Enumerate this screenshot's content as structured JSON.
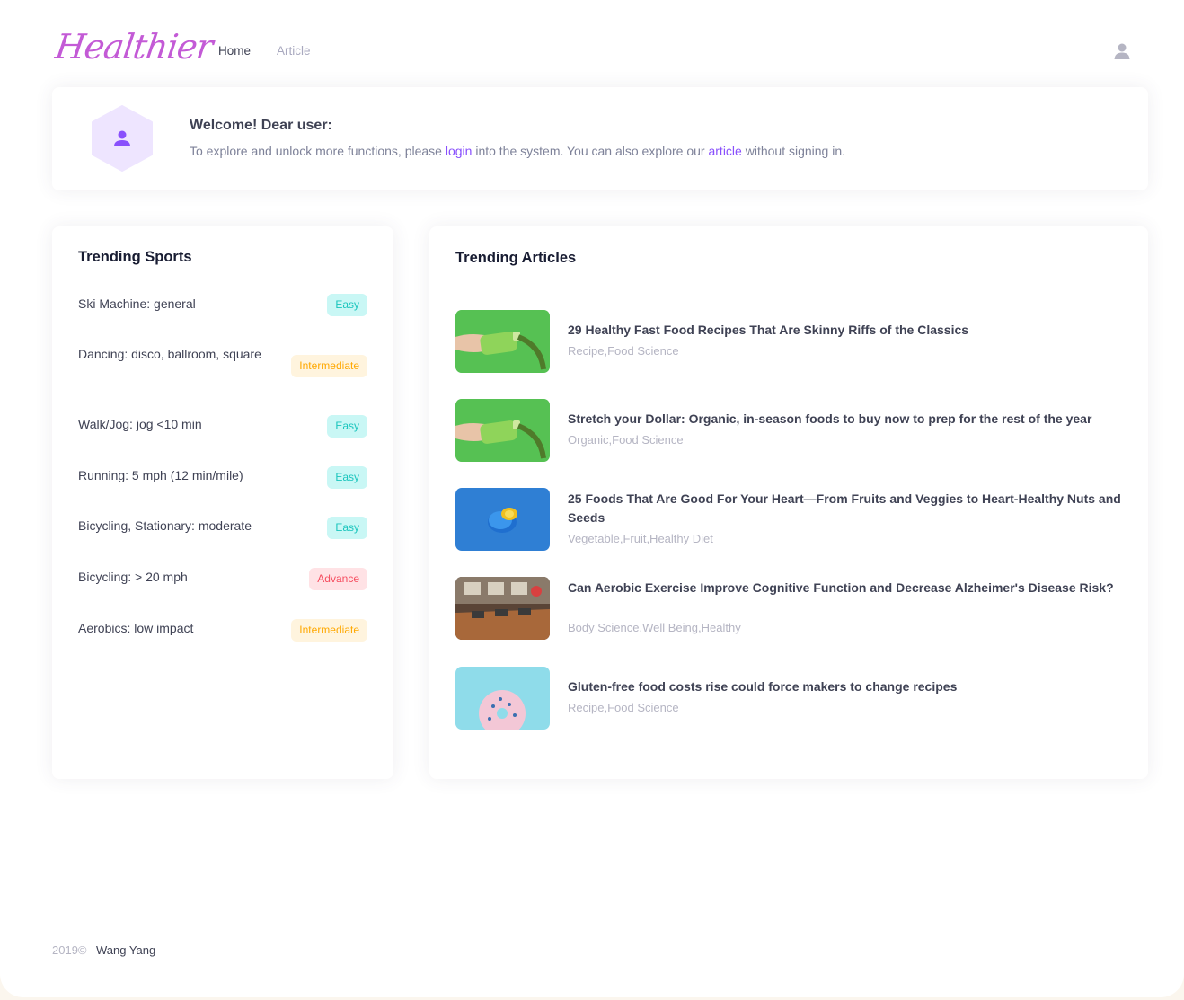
{
  "header": {
    "logo": "Healthier",
    "nav": [
      {
        "label": "Home"
      },
      {
        "label": "Article"
      }
    ],
    "user_icon": "user-icon"
  },
  "welcome": {
    "title": "Welcome! Dear user:",
    "text_before": "To explore and unlock more functions, please ",
    "login_link": "login",
    "text_middle": " into the system. You can also explore our ",
    "article_link": "article",
    "text_after": "  without signing in.",
    "icon": "user-icon"
  },
  "sports": {
    "title": "Trending Sports",
    "items": [
      {
        "name": "Ski Machine: general",
        "level": "Easy"
      },
      {
        "name": "Dancing: disco, ballroom, square",
        "level": "Intermediate"
      },
      {
        "name": "Walk/Jog: jog <10 min",
        "level": "Easy"
      },
      {
        "name": "Running: 5 mph (12 min/mile)",
        "level": "Easy"
      },
      {
        "name": "Bicycling, Stationary: moderate",
        "level": "Easy"
      },
      {
        "name": "Bicycling: > 20 mph",
        "level": "Advance"
      },
      {
        "name": "Aerobics: low impact",
        "level": "Intermediate"
      }
    ]
  },
  "articles": {
    "title": "Trending Articles",
    "items": [
      {
        "title": "29 Healthy Fast Food Recipes That Are Skinny Riffs of the Classics",
        "tags": "Recipe,Food Science",
        "image": "green-bottle-image"
      },
      {
        "title": "Stretch your Dollar: Organic, in-season foods to buy now to prep for the rest of the year",
        "tags": "Organic,Food Science",
        "image": "green-bottle-image"
      },
      {
        "title": "25 Foods That Are Good For Your Heart—From Fruits and Veggies to Heart-Healthy Nuts and Seeds",
        "tags": "Vegetable,Fruit,Healthy Diet",
        "image": "blue-fruit-image"
      },
      {
        "title": "Can Aerobic Exercise Improve Cognitive Function and Decrease Alzheimer's Disease Risk?",
        "tags": "Body Science,Well Being,Healthy",
        "image": "gym-image"
      },
      {
        "title": "Gluten-free food costs rise could force makers to change recipes",
        "tags": "Recipe,Food Science",
        "image": "donut-image"
      }
    ]
  },
  "footer": {
    "year": "2019©",
    "author": "Wang Yang"
  },
  "colors": {
    "accent": "#8950fc",
    "logo": "#c35ad6",
    "easy": "#1bc5bd",
    "intermediate": "#ffa800",
    "advance": "#f64e60"
  }
}
